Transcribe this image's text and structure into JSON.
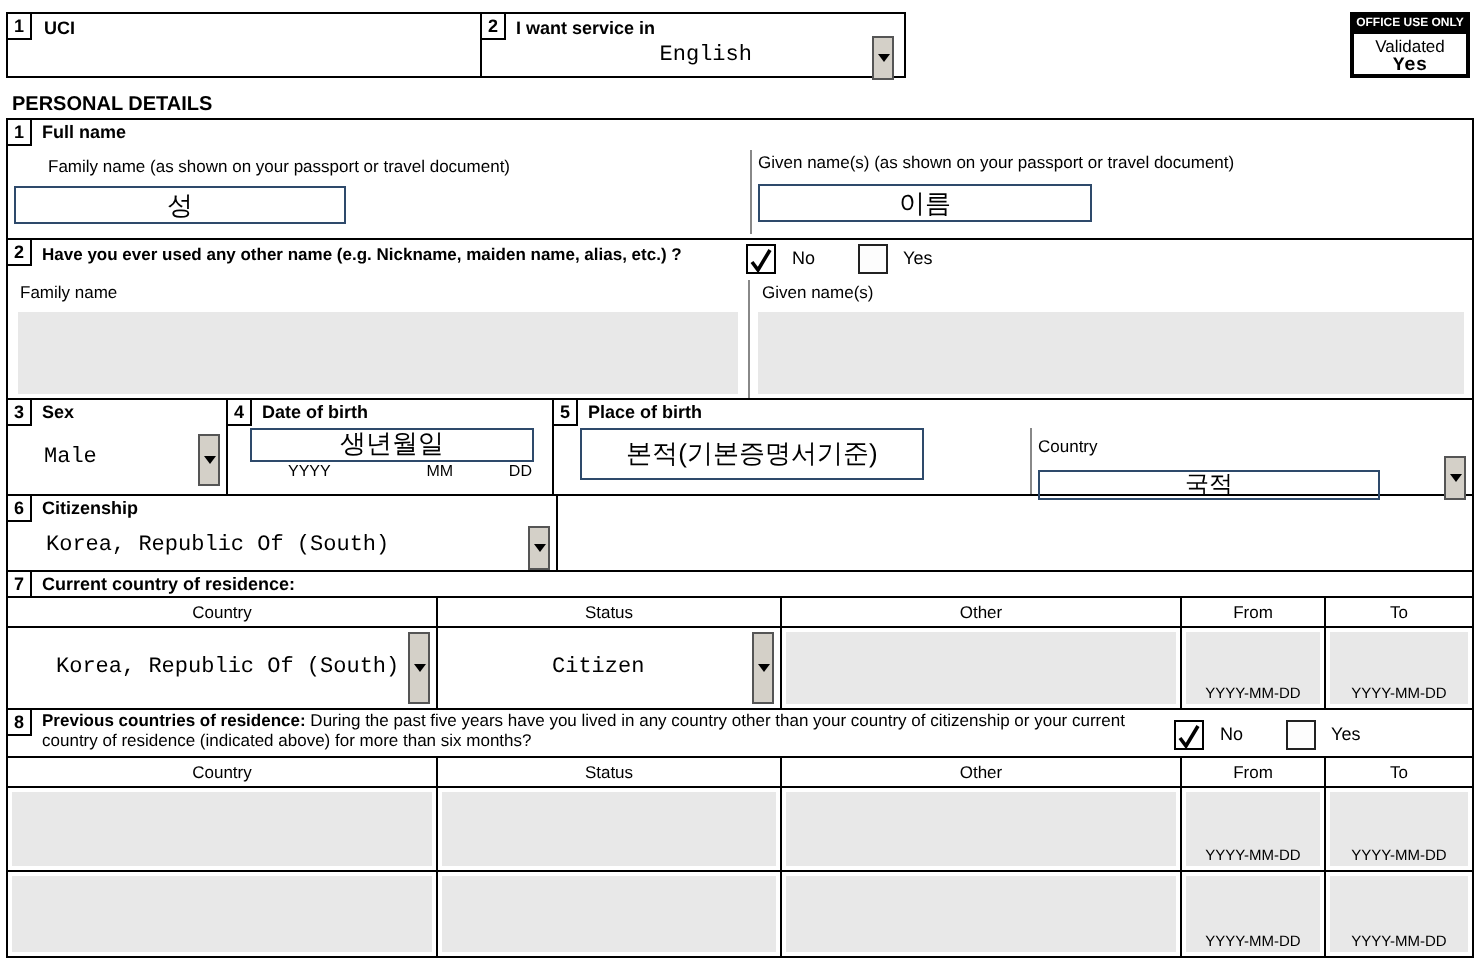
{
  "top": {
    "uci": {
      "number": "1",
      "label": "UCI"
    },
    "service": {
      "number": "2",
      "label": "I want service in",
      "value": "English"
    },
    "office": {
      "title": "OFFICE USE ONLY",
      "label": "Validated",
      "value": "Yes"
    }
  },
  "section_title": "PERSONAL DETAILS",
  "full_name": {
    "number": "1",
    "label": "Full name",
    "family_label": "Family name (as shown on your passport or travel document)",
    "family_value": "성",
    "given_label": "Given name(s) (as shown on your passport or travel document)",
    "given_value": "이름"
  },
  "other_name": {
    "number": "2",
    "question": "Have you ever used any other name (e.g. Nickname, maiden name, alias, etc.) ?",
    "options": [
      {
        "label": "No",
        "selected": true
      },
      {
        "label": "Yes",
        "selected": false
      }
    ],
    "family_label": "Family name",
    "given_label": "Given name(s)"
  },
  "sex": {
    "number": "3",
    "label": "Sex",
    "value": "Male"
  },
  "birth_date": {
    "number": "4",
    "label": "Date of birth",
    "value": "생년월일",
    "parts": [
      "YYYY",
      "MM",
      "DD"
    ]
  },
  "birth_place": {
    "number": "5",
    "label": "Place of birth",
    "value": "본적(기본증명서기준)",
    "country_label": "Country",
    "country_value": "국적"
  },
  "citizenship": {
    "number": "6",
    "label": "Citizenship",
    "value": "Korea, Republic Of (South)"
  },
  "current_residence": {
    "number": "7",
    "label": "Current country of residence:",
    "columns": [
      "Country",
      "Status",
      "Other",
      "From",
      "To"
    ],
    "rows": [
      {
        "country": "Korea, Republic Of (South)",
        "status": "Citizen",
        "from_format": "YYYY-MM-DD",
        "to_format": "YYYY-MM-DD"
      }
    ]
  },
  "previous_residence": {
    "number": "8",
    "question": "**Previous countries of residence:** During the past five years have you lived in any country other than your country of citizenship or your current country of residence (indicated above) for more than six months?",
    "options": [
      {
        "label": "No",
        "selected": true
      },
      {
        "label": "Yes",
        "selected": false
      }
    ],
    "columns": [
      "Country",
      "Status",
      "Other",
      "From",
      "To"
    ],
    "rows": [
      {
        "from_format": "YYYY-MM-DD",
        "to_format": "YYYY-MM-DD"
      },
      {
        "from_format": "YYYY-MM-DD",
        "to_format": "YYYY-MM-DD"
      }
    ]
  }
}
